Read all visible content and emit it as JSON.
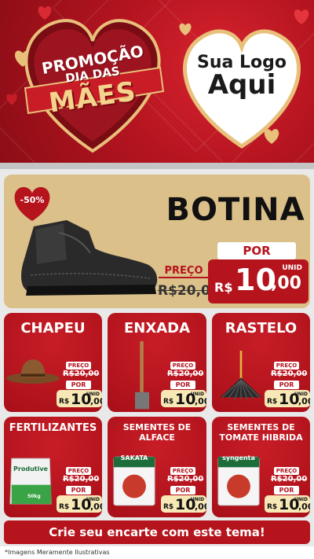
{
  "header": {
    "promo_line1": "PROMOÇÃO",
    "promo_line2": "DIA DAS",
    "promo_line3": "MÃES",
    "logo_line1": "Sua Logo",
    "logo_line2": "Aqui"
  },
  "featured": {
    "discount": "-50%",
    "title": "BOTINA",
    "preco_label": "PREÇO",
    "old_price": "R$20,00",
    "por_label": "POR",
    "unid_label": "UNID",
    "currency": "R$",
    "new_price_int": "10",
    "new_price_dec": ",00",
    "image_icon": "boot-icon"
  },
  "products": [
    {
      "title": "CHAPEU",
      "preco_label": "PREÇO",
      "old_price": "R$20,00",
      "por_label": "POR",
      "unid_label": "UNID",
      "currency": "R$",
      "new_int": "10",
      "new_dec": ",00",
      "icon": "hat-icon"
    },
    {
      "title": "ENXADA",
      "preco_label": "PREÇO",
      "old_price": "R$20,00",
      "por_label": "POR",
      "unid_label": "UNID",
      "currency": "R$",
      "new_int": "10",
      "new_dec": ",00",
      "icon": "hoe-icon"
    },
    {
      "title": "RASTELO",
      "preco_label": "PREÇO",
      "old_price": "R$20,00",
      "por_label": "POR",
      "unid_label": "UNID",
      "currency": "R$",
      "new_int": "10",
      "new_dec": ",00",
      "icon": "rake-icon"
    },
    {
      "title": "FERTILIZANTES",
      "preco_label": "PREÇO",
      "old_price": "R$20,00",
      "por_label": "POR",
      "unid_label": "UNID",
      "currency": "R$",
      "new_int": "10",
      "new_dec": ",00",
      "icon": "fertilizer-bag-icon",
      "pkg_text": "Produtive",
      "pkg_weight": "50kg"
    },
    {
      "title": "SEMENTES DE ALFACE",
      "preco_label": "PREÇO",
      "old_price": "R$20,00",
      "por_label": "POR",
      "unid_label": "UNID",
      "currency": "R$",
      "new_int": "10",
      "new_dec": ",00",
      "icon": "seed-packet-icon",
      "pkg_text": "SAKATA"
    },
    {
      "title": "SEMENTES DE TOMATE HIBRIDA",
      "preco_label": "PREÇO",
      "old_price": "R$20,00",
      "por_label": "POR",
      "unid_label": "UNID",
      "currency": "R$",
      "new_int": "10",
      "new_dec": ",00",
      "icon": "seed-packet-icon",
      "pkg_text": "syngenta"
    }
  ],
  "cta": "Crie seu encarte com este tema!",
  "footer": "*Imagens Meramente Ilustrativas",
  "colors": {
    "primary_red": "#b5141d",
    "gold": "#dcc08a",
    "cream": "#f7e8b6"
  }
}
